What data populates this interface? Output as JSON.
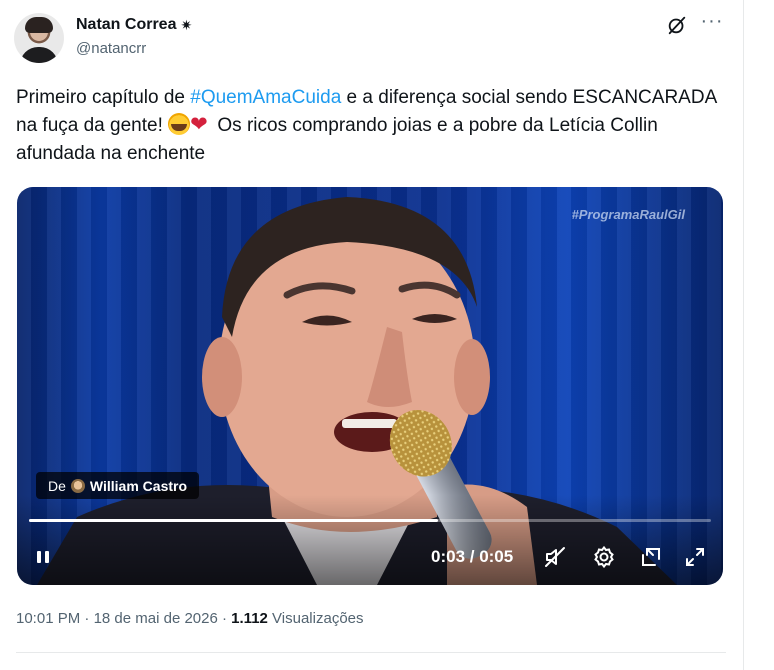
{
  "author": {
    "name": "Natan Correa",
    "badge": "✷",
    "handle": "@natancrr"
  },
  "tweet": {
    "text_before_hashtag": "Primeiro capítulo de ",
    "hashtag": "#QuemAmaCuida",
    "text_after_hashtag": " e a diferença social sendo ESCANCARADA na fuça da gente! ",
    "emojis": [
      "loudly-crying-face",
      "mending-heart"
    ],
    "text_after_emojis": " Os ricos comprando joias e a pobre da Letícia Collin afundada na enchente"
  },
  "video": {
    "watermark": "#ProgramaRaulGil",
    "source_prefix": "De",
    "source_name": "William Castro",
    "time_display": "0:03 / 0:05",
    "progress": 0.6,
    "controls": [
      "pause-icon",
      "mute-icon",
      "settings-icon",
      "pip-icon",
      "fullscreen-icon"
    ]
  },
  "meta": {
    "time": "10:01 PM",
    "separator1": " · ",
    "date": "18 de mai de 2026",
    "separator2": " · ",
    "views_count": "1.112",
    "views_label": " Visualizações"
  },
  "colors": {
    "link": "#1d9bf0",
    "text": "#0f1419",
    "secondary": "#536471"
  }
}
